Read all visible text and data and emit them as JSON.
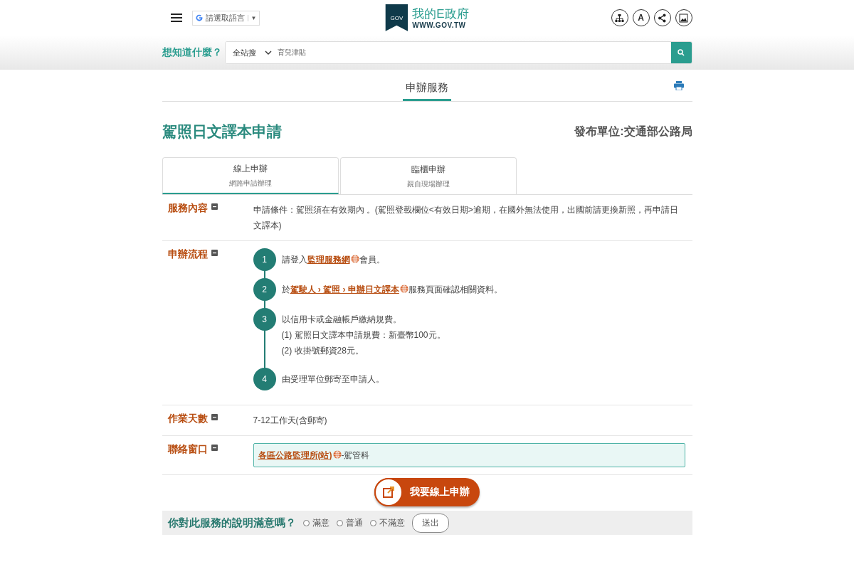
{
  "header": {
    "language_selector": "請選取語言",
    "language_arrow": "▼",
    "logo_badge": "GOV",
    "logo_title": "我的E政府",
    "logo_subtitle": "WWW.GOV.TW",
    "font_button": "A"
  },
  "search": {
    "label": "想知道什麼？",
    "scope": "全站搜",
    "value": "育兒津貼"
  },
  "section_tab": "申辦服務",
  "title": "駕照日文譯本申請",
  "publisher": "發布單位:交通部公路局",
  "tabs": [
    {
      "label": "線上申辦",
      "sub": "網路申請辦理",
      "selected": true
    },
    {
      "label": "臨櫃申辦",
      "sub": "親自現場辦理",
      "selected": false
    }
  ],
  "rows": [
    {
      "kind": "text",
      "label": "服務內容",
      "text": "申請條件：駕照須在有效期內 。(駕照登載欄位<有效日期>逾期，在國外無法使用，出國前請更換新照，再申請日文譯本)"
    },
    {
      "kind": "steps",
      "label": "申辦流程",
      "steps": [
        {
          "number": "1",
          "before": "請登入",
          "link": "監理服務網",
          "after": "會員。"
        },
        {
          "number": "2",
          "before": "於",
          "link": "駕駛人 › 駕照 › 申辦日文譯本",
          "after": "服務頁面確認相關資料。"
        },
        {
          "number": "3",
          "before": "以信用卡或金融帳戶繳納規費。",
          "lines": [
            "(1) 駕照日文譯本申請規費：新臺幣100元。",
            "(2) 收掛號郵資28元。"
          ]
        },
        {
          "number": "4",
          "before": "由受理單位郵寄至申請人。"
        }
      ]
    },
    {
      "kind": "text",
      "label": "作業天數",
      "text": "7-12工作天(含郵寄)"
    },
    {
      "kind": "contact",
      "label": "聯絡窗口",
      "link": "各區公路監理所(站)",
      "after": "-駕管科"
    }
  ],
  "apply_button": "我要線上申辦",
  "survey": {
    "question": "你對此服務的說明滿意嗎？",
    "options": [
      {
        "label": "滿意",
        "selected": false
      },
      {
        "label": "普通",
        "selected": false
      },
      {
        "label": "不滿意",
        "selected": false
      }
    ],
    "submit": "送出"
  }
}
